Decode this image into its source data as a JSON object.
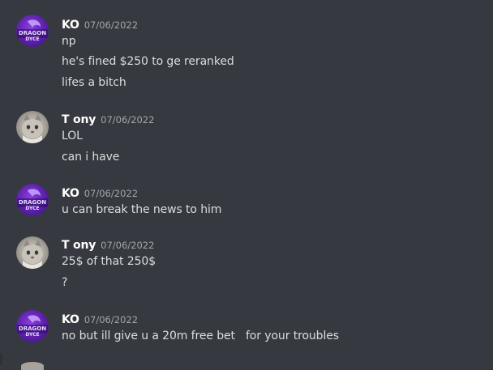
{
  "messages": [
    {
      "author": "KO",
      "timestamp": "07/06/2022",
      "avatar": "dragon-logo-avatar",
      "avatar_text": [
        "DRAGON",
        "DYCE"
      ],
      "lines": [
        "np",
        "he's fined $250 to ge reranked",
        "lifes a bitch"
      ]
    },
    {
      "author": "T ony",
      "timestamp": "07/06/2022",
      "avatar": "cat-photo-avatar",
      "lines": [
        "LOL",
        "can i have"
      ]
    },
    {
      "author": "KO",
      "timestamp": "07/06/2022",
      "avatar": "dragon-logo-avatar",
      "avatar_text": [
        "DRAGON",
        "DYCE"
      ],
      "lines": [
        "u can break the news to him"
      ]
    },
    {
      "author": "T ony",
      "timestamp": "07/06/2022",
      "avatar": "cat-photo-avatar",
      "lines": [
        "25$ of that 250$",
        "?"
      ]
    },
    {
      "author": "KO",
      "timestamp": "07/06/2022",
      "avatar": "dragon-logo-avatar",
      "avatar_text": [
        "DRAGON",
        "DYCE"
      ],
      "lines": [
        "no but ill give u a 20m free bet   for your troubles"
      ]
    }
  ],
  "colors": {
    "background": "#36393f",
    "author": "#ffffff",
    "text": "#dcddde",
    "timestamp": "#a3a6aa",
    "dragon_purple": "#6a2bc4"
  }
}
